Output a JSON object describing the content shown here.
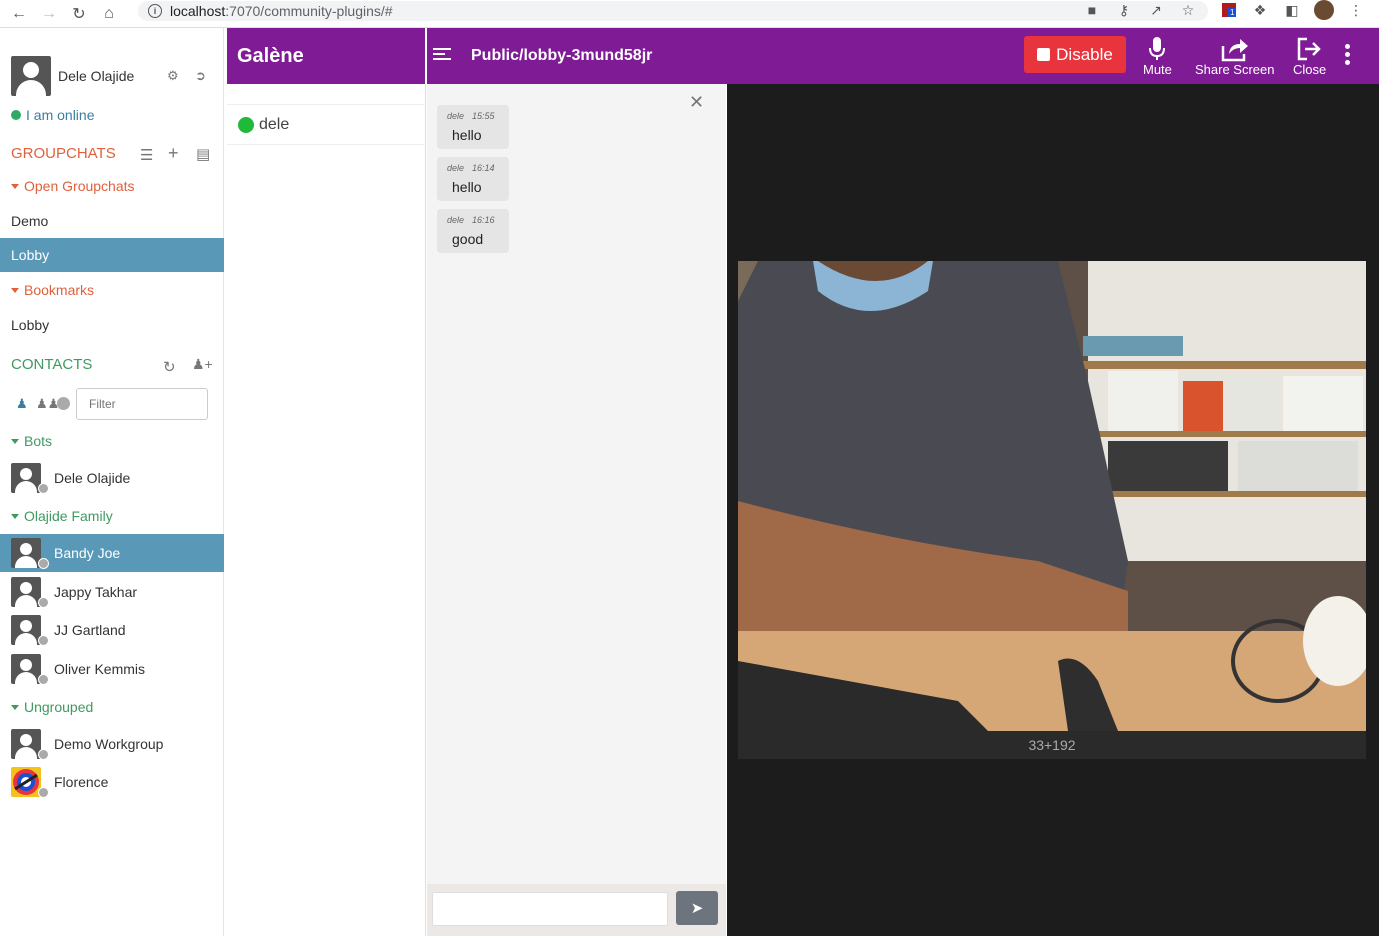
{
  "browser": {
    "url_host": "localhost",
    "url_rest": ":7070/community-plugins/#",
    "badge_count": "1"
  },
  "sidebar": {
    "profile_name": "Dele Olajide",
    "status": "I am online",
    "groupchats_heading": "GROUPCHATS",
    "open_groupchats": "Open Groupchats",
    "rooms": [
      "Demo",
      "Lobby"
    ],
    "bookmarks": "Bookmarks",
    "bookmark_rooms": [
      "Lobby"
    ],
    "contacts_heading": "CONTACTS",
    "filter_placeholder": "Filter",
    "groups": {
      "bots": "Bots",
      "family": "Olajide Family",
      "ungrouped": "Ungrouped"
    },
    "contacts": {
      "bots": [
        "Dele Olajide"
      ],
      "family": [
        "Bandy Joe",
        "Jappy Takhar",
        "JJ Gartland",
        "Oliver Kemmis"
      ],
      "ungrouped": [
        "Demo Workgroup",
        "Florence"
      ]
    }
  },
  "galene": {
    "app_title": "Galène",
    "room_title": "Public/lobby-3mund58jr",
    "disable_label": "Disable",
    "mute_label": "Mute",
    "share_label": "Share Screen",
    "close_label": "Close",
    "users": [
      "dele"
    ]
  },
  "chat": {
    "messages": [
      {
        "user": "dele",
        "time": "15:55",
        "text": "hello"
      },
      {
        "user": "dele",
        "time": "16:14",
        "text": "hello"
      },
      {
        "user": "dele",
        "time": "16:16",
        "text": "good"
      }
    ]
  },
  "video": {
    "label": "33+192"
  },
  "colors": {
    "header_purple": "#7e1b95",
    "active_blue": "#5a98b8",
    "groupchat_orange": "#e0603c",
    "contacts_green": "#3f9a5f",
    "disable_red": "#e8343d",
    "online_green": "#1fba3a"
  }
}
